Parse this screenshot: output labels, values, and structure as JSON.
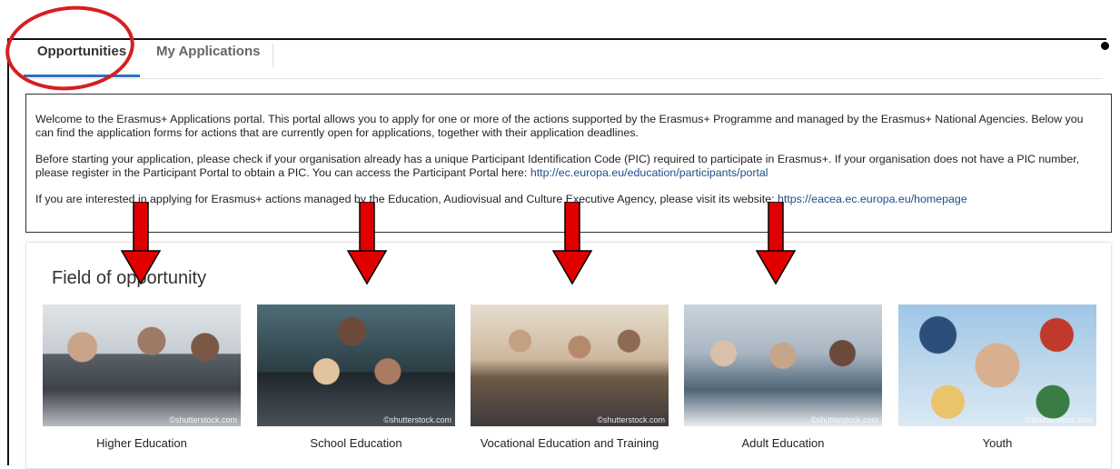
{
  "tabs": [
    {
      "label": "Opportunities",
      "active": true
    },
    {
      "label": "My Applications",
      "active": false
    }
  ],
  "info": {
    "p1": "Welcome to the Erasmus+ Applications portal. This portal allows you to apply for one or more of the actions supported by the Erasmus+ Programme and managed by the Erasmus+ National Agencies. Below you can find the application forms for actions that are currently open for applications, together with their application deadlines.",
    "p2_text": "Before starting your application, please check if your organisation already has a unique Participant Identification Code (PIC) required to participate in Erasmus+. If your organisation does not have a PIC number, please register in the Participant Portal to obtain a PIC. You can access the Participant Portal here: ",
    "p2_link": "http://ec.europa.eu/education/participants/portal",
    "p3_text": "If you are interested in applying for Erasmus+ actions managed by the Education, Audiovisual and Culture Executive Agency, please visit its website: ",
    "p3_link": "https://eacea.ec.europa.eu/homepage"
  },
  "card": {
    "title": "Field of opportunity",
    "watermark": "©shutterstock.com",
    "fields": [
      {
        "label": "Higher Education"
      },
      {
        "label": "School Education"
      },
      {
        "label": "Vocational Education and Training"
      },
      {
        "label": "Adult Education"
      },
      {
        "label": "Youth"
      }
    ]
  },
  "annotation_colors": {
    "ellipse": "#d61f1f",
    "arrow": "#e00000"
  },
  "accent_color": "#2f6fc2",
  "link_color": "#1d4f88"
}
